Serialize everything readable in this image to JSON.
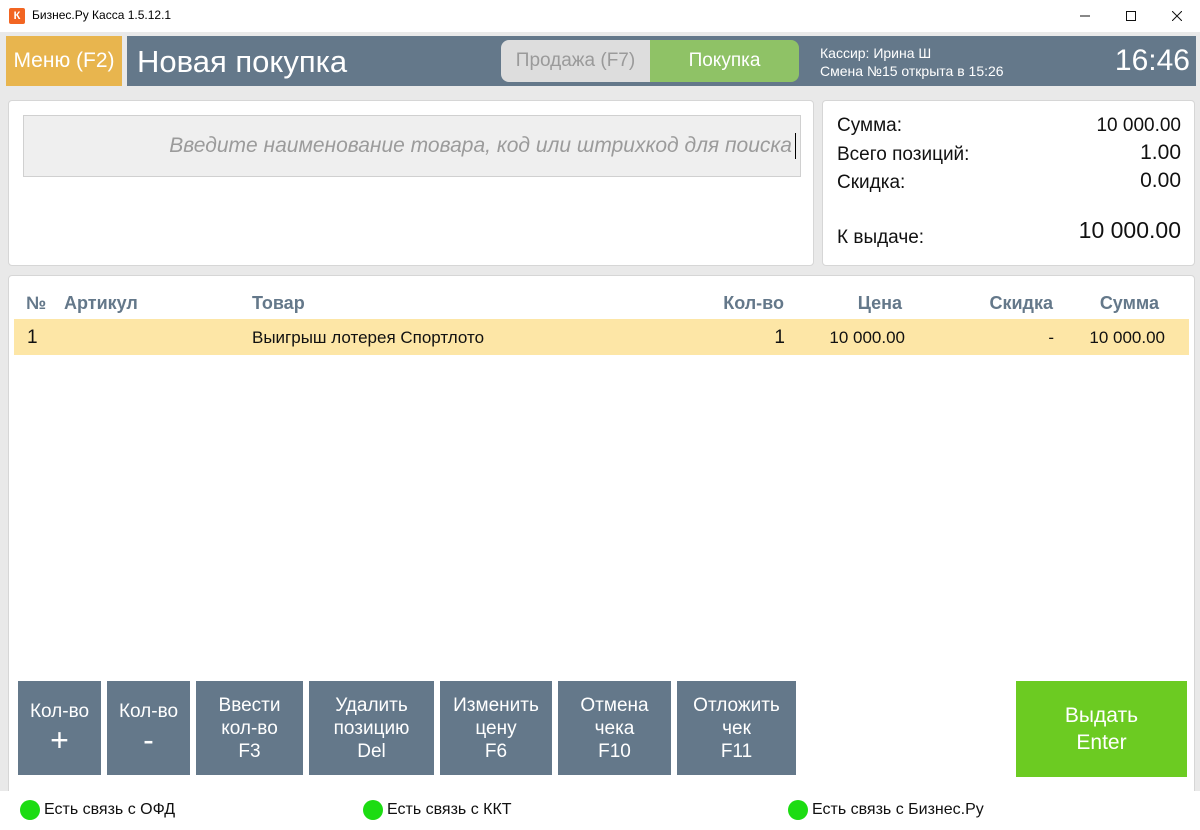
{
  "window": {
    "title": "Бизнес.Ру Касса 1.5.12.1",
    "icon_letter": "К"
  },
  "header": {
    "menu_label": "Меню (F2)",
    "page_title": "Новая покупка",
    "mode_sale": "Продажа (F7)",
    "mode_purchase": "Покупка",
    "cashier": "Кассир: Ирина Ш",
    "shift": "Смена №15 открыта в 15:26",
    "clock": "16:46"
  },
  "search": {
    "placeholder": "Введите наименование товара, код или штрихкод для поиска"
  },
  "summary": {
    "sum_label": "Сумма:",
    "sum_value": "10 000.00",
    "positions_label": "Всего позиций:",
    "positions_value": "1.00",
    "discount_label": "Скидка:",
    "discount_value": "0.00",
    "payout_label": "К выдаче:",
    "payout_value": "10 000.00"
  },
  "table": {
    "headers": [
      "№",
      "Артикул",
      "Товар",
      "Кол-во",
      "Цена",
      "Скидка",
      "Сумма"
    ],
    "rows": [
      {
        "num": "1",
        "article": "",
        "product": "Выигрыш лотерея Спортлото",
        "qty": "1",
        "price": "10 000.00",
        "discount": "-",
        "total": "10 000.00"
      }
    ]
  },
  "actions": {
    "qty_plus": {
      "line1": "Кол-во",
      "line2": "+"
    },
    "qty_minus": {
      "line1": "Кол-во",
      "line2": "-"
    },
    "enter_qty": {
      "line1": "Ввести",
      "line2": "кол-во",
      "line3": "F3"
    },
    "delete_pos": {
      "line1": "Удалить",
      "line2": "позицию",
      "line3": "Del"
    },
    "change_price": {
      "line1": "Изменить",
      "line2": "цену",
      "line3": "F6"
    },
    "cancel_check": {
      "line1": "Отмена",
      "line2": "чека",
      "line3": "F10"
    },
    "defer_check": {
      "line1": "Отложить",
      "line2": "чек",
      "line3": "F11"
    },
    "issue": {
      "line1": "Выдать",
      "line2": "Enter"
    }
  },
  "status": {
    "ofd": "Есть связь с ОФД",
    "kkt": "Есть связь с ККТ",
    "bizru": "Есть связь с Бизнес.Ру",
    "led_color": "#1cdc12"
  },
  "colors": {
    "accent": "#64788a",
    "menu": "#e8b54e",
    "purchase": "#8fc266",
    "issue": "#6ccb22",
    "row_highlight": "#fde6a6"
  }
}
